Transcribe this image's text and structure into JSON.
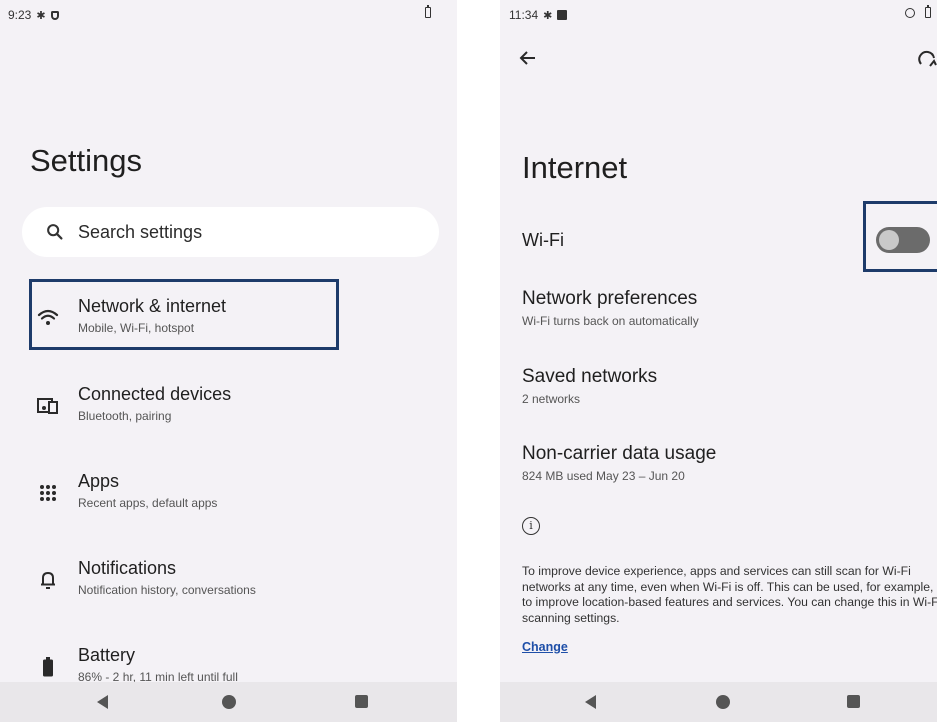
{
  "left": {
    "status": {
      "time": "9:23"
    },
    "title": "Settings",
    "search": {
      "placeholder": "Search settings"
    },
    "items": [
      {
        "title": "Network & internet",
        "subtitle": "Mobile, Wi-Fi, hotspot",
        "icon": "wifi-icon"
      },
      {
        "title": "Connected devices",
        "subtitle": "Bluetooth, pairing",
        "icon": "devices-icon"
      },
      {
        "title": "Apps",
        "subtitle": "Recent apps, default apps",
        "icon": "apps-grid-icon"
      },
      {
        "title": "Notifications",
        "subtitle": "Notification history, conversations",
        "icon": "bell-icon"
      },
      {
        "title": "Battery",
        "subtitle": "86% - 2 hr, 11 min left until full",
        "icon": "battery-icon"
      }
    ],
    "highlight_color": "#1d3b6a"
  },
  "right": {
    "status": {
      "time": "11:34"
    },
    "title": "Internet",
    "wifi": {
      "label": "Wi-Fi",
      "enabled": false
    },
    "items": [
      {
        "title": "Network preferences",
        "subtitle": "Wi-Fi turns back on automatically"
      },
      {
        "title": "Saved networks",
        "subtitle": "2 networks"
      },
      {
        "title": "Non-carrier data usage",
        "subtitle": "824 MB used May 23 – Jun 20"
      }
    ],
    "info_text": "To improve device experience, apps and services can still scan for Wi-Fi networks at any time, even when Wi-Fi is off. This can be used, for example, to improve location-based features and services. You can change this in Wi-Fi scanning settings.",
    "change_link": "Change"
  }
}
